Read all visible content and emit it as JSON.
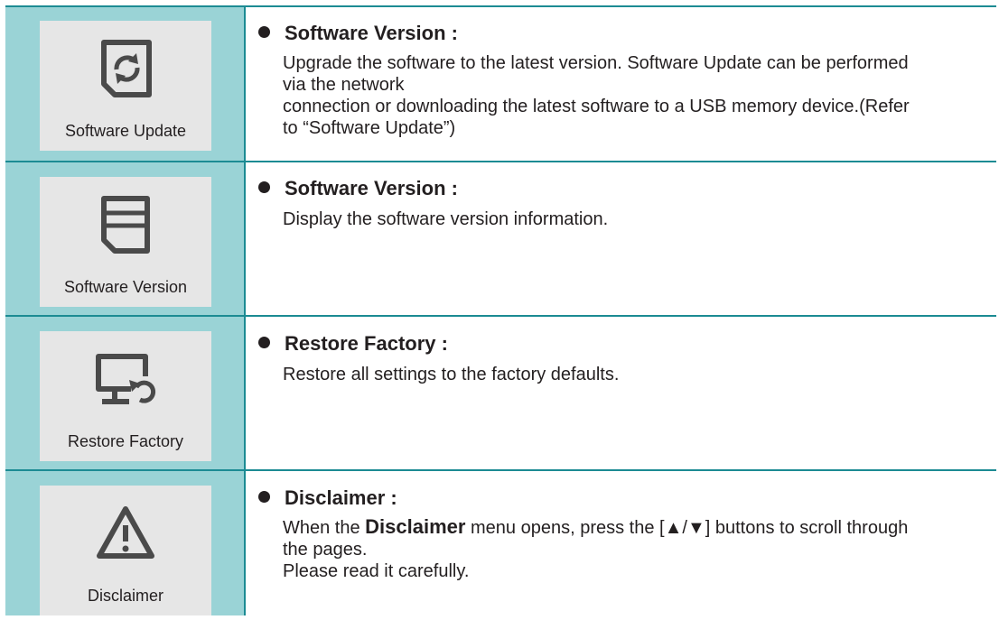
{
  "rows": [
    {
      "tile_label": "Software Update",
      "icon": "update-icon",
      "heading": "Software Version :",
      "lines": [
        "Upgrade the software to the latest version. Software Update can be performed",
        "via the network",
        "connection or downloading the latest software to a USB memory device.(Refer",
        "to “Software Update”)"
      ]
    },
    {
      "tile_label": "Software Version",
      "icon": "version-icon",
      "heading": "Software Version :",
      "lines": [
        "Display the software version information."
      ]
    },
    {
      "tile_label": "Restore Factory",
      "icon": "restore-monitor-icon",
      "heading": "Restore Factory :",
      "lines": [
        "Restore all settings to the factory defaults."
      ]
    },
    {
      "tile_label": "Disclaimer",
      "icon": "warning-icon",
      "heading": "Disclaimer :",
      "line1_before": "When the ",
      "line1_bold": "Disclaimer",
      "line1_after": " menu opens, press the [▲/▼] buttons to scroll through",
      "line2": "the pages.",
      "line3": "Please read it carefully."
    }
  ],
  "colors": {
    "rule": "#1c8b93",
    "left_bg": "#9ad3d6",
    "tile_bg": "#e6e6e6",
    "text": "#231f20"
  }
}
